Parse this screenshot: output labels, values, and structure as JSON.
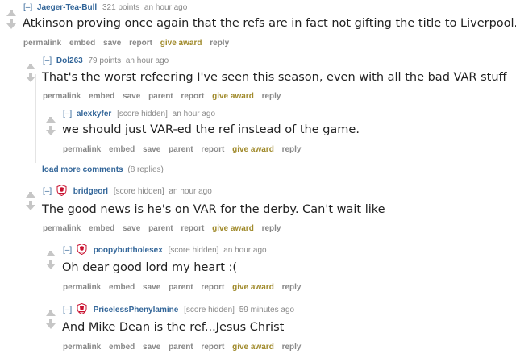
{
  "comments": [
    {
      "expand": "[–]",
      "author": "Jaeger-Tea-Bull",
      "score": "321 points",
      "time": "an hour ago",
      "text": "Atkinson proving once again that the refs are in fact not gifting the title to Liverpool.",
      "buttons": [
        "permalink",
        "embed",
        "save",
        "report",
        "give award",
        "reply"
      ]
    },
    {
      "expand": "[–]",
      "author": "Dol263",
      "score": "79 points",
      "time": "an hour ago",
      "text": "That's the worst refeering I've seen this season, even with all the bad VAR stuff",
      "buttons": [
        "permalink",
        "embed",
        "save",
        "parent",
        "report",
        "give award",
        "reply"
      ]
    },
    {
      "expand": "[–]",
      "author": "alexkyfer",
      "score": "[score hidden]",
      "time": "an hour ago",
      "text": "we should just VAR-ed the ref instead of the game.",
      "buttons": [
        "permalink",
        "embed",
        "save",
        "parent",
        "report",
        "give award",
        "reply"
      ]
    },
    {
      "expand": "[–]",
      "author": "bridgeorl",
      "score": "[score hidden]",
      "time": "an hour ago",
      "text": "The good news is he's on VAR for the derby. Can't wait like",
      "buttons": [
        "permalink",
        "embed",
        "save",
        "parent",
        "report",
        "give award",
        "reply"
      ]
    },
    {
      "expand": "[–]",
      "author": "poopybuttholesex",
      "score": "[score hidden]",
      "time": "an hour ago",
      "text": "Oh dear good lord my heart :(",
      "buttons": [
        "permalink",
        "embed",
        "save",
        "parent",
        "report",
        "give award",
        "reply"
      ]
    },
    {
      "expand": "[–]",
      "author": "PricelessPhenylamine",
      "score": "[score hidden]",
      "time": "59 minutes ago",
      "text": "And Mike Dean is the ref...Jesus Christ",
      "buttons": [
        "permalink",
        "embed",
        "save",
        "parent",
        "report",
        "give award",
        "reply"
      ]
    }
  ],
  "load_more": {
    "link": "load more comments",
    "count": "(8 replies)"
  },
  "colors": {
    "author": "#336699",
    "award": "#a08a2b",
    "meta": "#888888",
    "flair_red": "#c8102e"
  },
  "icons": {
    "upvote": "upvote-arrow-icon",
    "downvote": "downvote-arrow-icon",
    "flair": "liverpool-crest-flair-icon"
  }
}
